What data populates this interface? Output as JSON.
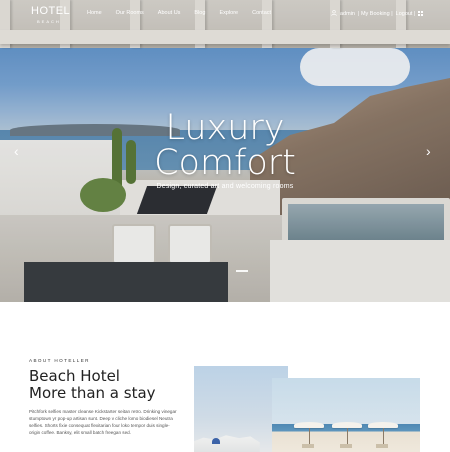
{
  "brand": {
    "name": "HOTEL",
    "tagline": "BEACH"
  },
  "nav": {
    "items": [
      "Home",
      "Our Rooms",
      "About Us",
      "Blog",
      "Explore",
      "Contact"
    ],
    "user": {
      "icon": "user-icon",
      "admin_label": "admin",
      "my_booking_label": "| My Booking |",
      "logout_label": "Logout |",
      "extra_icon": "grid-icon"
    }
  },
  "hero": {
    "headline_line1": "Luxury",
    "headline_line2": "Comfort",
    "subtitle": "Design, curated art and welcoming rooms",
    "prev_icon": "‹",
    "next_icon": "›"
  },
  "about": {
    "kicker": "ABOUT HOTELLER",
    "title_line1": "Beach Hotel",
    "title_line2": "More than a stay",
    "body": "Pitchfork selfies master cleanse Kickstarter seitan retro. Drinking vinegar stumptown yr pop-up artisan sunt. Deep v cliche lomo biodiesel Neutra selfies. Shorts fixie consequat flexitarian four loko tempor duis single-origin coffee. Banksy, elit small batch freegan sed."
  },
  "colors": {
    "text_dark": "#222222",
    "white": "#ffffff"
  }
}
